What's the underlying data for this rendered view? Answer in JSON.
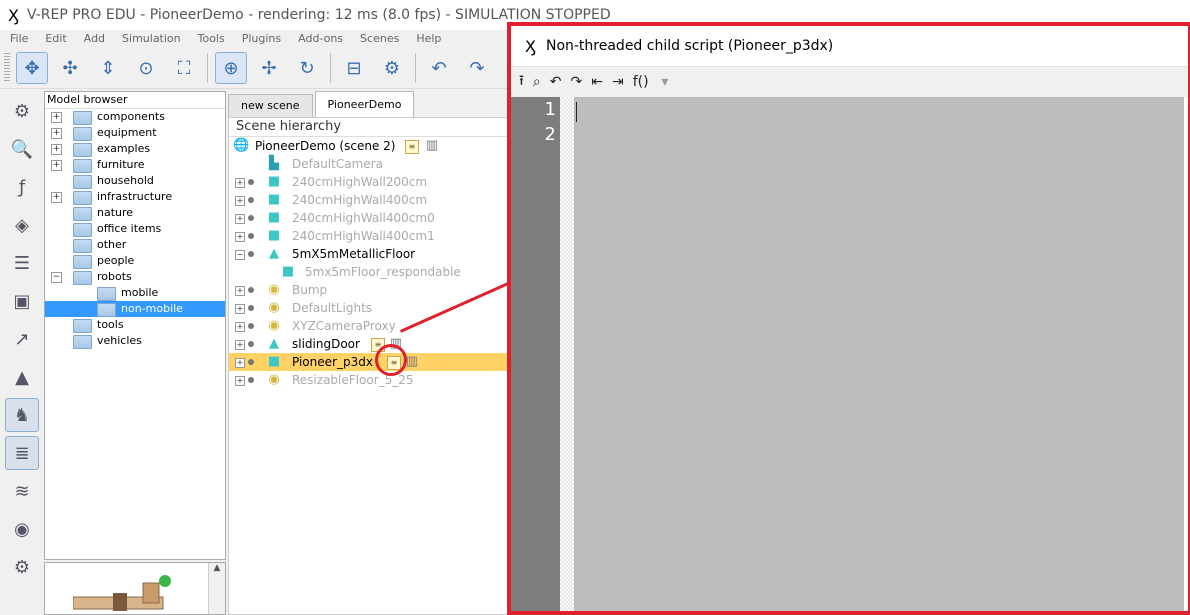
{
  "window": {
    "title": "V-REP PRO EDU - PioneerDemo - rendering: 12 ms (8.0 fps) - SIMULATION STOPPED",
    "logo_icon": "vrep-logo-icon"
  },
  "menu": [
    "File",
    "Edit",
    "Add",
    "Simulation",
    "Tools",
    "Plugins",
    "Add-ons",
    "Scenes",
    "Help"
  ],
  "model_browser": {
    "title": "Model browser",
    "items": [
      {
        "label": "components",
        "expandable": true
      },
      {
        "label": "equipment",
        "expandable": true
      },
      {
        "label": "examples",
        "expandable": true
      },
      {
        "label": "furniture",
        "expandable": true
      },
      {
        "label": "household",
        "expandable": false
      },
      {
        "label": "infrastructure",
        "expandable": true
      },
      {
        "label": "nature",
        "expandable": false
      },
      {
        "label": "office items",
        "expandable": false
      },
      {
        "label": "other",
        "expandable": false
      },
      {
        "label": "people",
        "expandable": false
      },
      {
        "label": "robots",
        "expandable": true
      },
      {
        "label": "mobile",
        "expandable": false
      },
      {
        "label": "non-mobile",
        "expandable": false
      },
      {
        "label": "tools",
        "expandable": false
      },
      {
        "label": "vehicles",
        "expandable": false
      }
    ]
  },
  "tabs": [
    "new scene",
    "PioneerDemo"
  ],
  "scene": {
    "header": "Scene hierarchy",
    "root": "PioneerDemo (scene 2)",
    "items": [
      {
        "name": "DefaultCamera",
        "dim": true
      },
      {
        "name": "240cmHighWall200cm",
        "dim": true
      },
      {
        "name": "240cmHighWall400cm",
        "dim": true
      },
      {
        "name": "240cmHighWall400cm0",
        "dim": true
      },
      {
        "name": "240cmHighWall400cm1",
        "dim": true
      },
      {
        "name": "5mX5mMetallicFloor",
        "dim": false
      },
      {
        "name": "5mx5mFloor_respondable",
        "dim": true
      },
      {
        "name": "Bump",
        "dim": true
      },
      {
        "name": "DefaultLights",
        "dim": true
      },
      {
        "name": "XYZCameraProxy",
        "dim": true
      },
      {
        "name": "slidingDoor",
        "dim": false
      },
      {
        "name": "Pioneer_p3dx",
        "dim": false,
        "selected": true
      },
      {
        "name": "ResizableFloor_5_25",
        "dim": true
      }
    ]
  },
  "editor": {
    "title": "Non-threaded child script (Pioneer_p3dx)",
    "toolbar_fx": "f()",
    "line_numbers": [
      "1",
      "2"
    ]
  },
  "colors": {
    "highlight": "#e0202a",
    "selection": "#ffd266",
    "browser_selection": "#3399ff",
    "code_bg": "#bdbdbd"
  }
}
